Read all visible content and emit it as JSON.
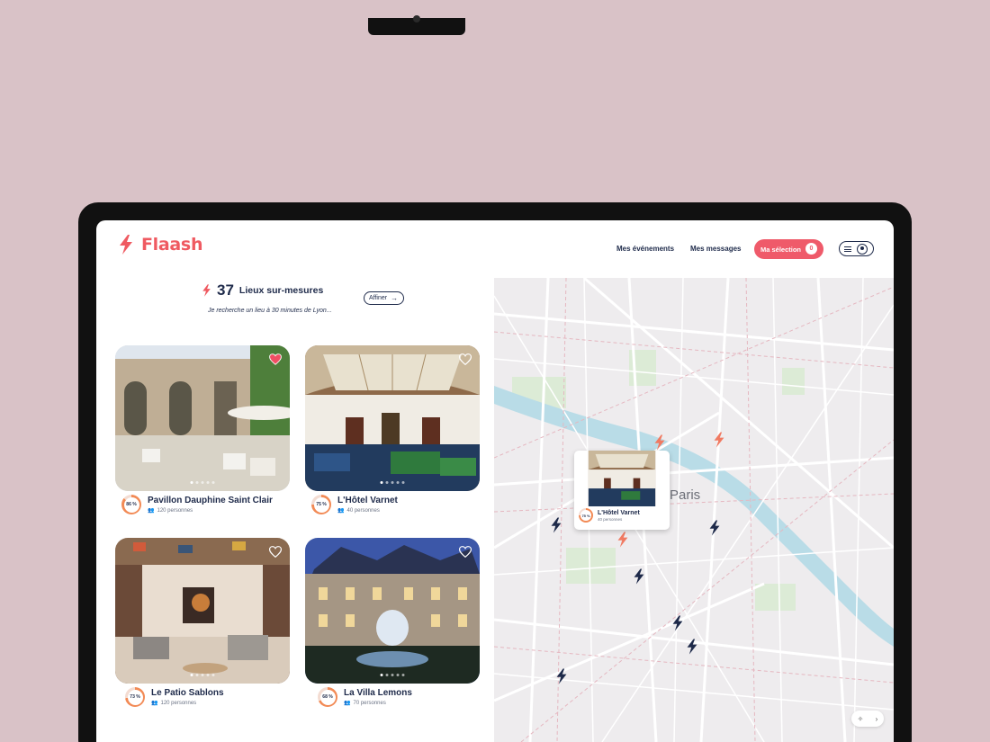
{
  "brand": {
    "name": "Flaash",
    "accent": "#ef5a61",
    "navy": "#1e2a4a"
  },
  "nav": {
    "events": "Mes événements",
    "messages": "Mes messages",
    "selection": "Ma sélection",
    "selection_count": "0"
  },
  "summary": {
    "count": "37",
    "label": "Lieux sur-mesures",
    "refine": "Affiner",
    "query": "Je recherche un lieu à 30 minutes de Lyon..."
  },
  "venues": [
    {
      "name": "Pavillon Dauphine Saint Clair",
      "score": "86 %",
      "score_value": 0.86,
      "capacity": "120 personnes",
      "favorite": true
    },
    {
      "name": "L'Hôtel Varnet",
      "score": "75 %",
      "score_value": 0.75,
      "capacity": "40 personnes",
      "favorite": false
    },
    {
      "name": "Le Patio Sablons",
      "score": "73 %",
      "score_value": 0.73,
      "capacity": "120 personnes",
      "favorite": false
    },
    {
      "name": "La Villa Lemons",
      "score": "68 %",
      "score_value": 0.68,
      "capacity": "70 personnes",
      "favorite": false
    }
  ],
  "map": {
    "city": "Paris",
    "popup": {
      "name": "L'Hôtel Varnet",
      "score": "75 %",
      "capacity": "40 personnes"
    }
  }
}
